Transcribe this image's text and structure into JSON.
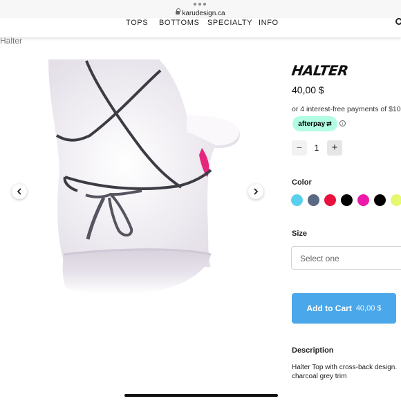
{
  "browser": {
    "url": "karudesign.ca"
  },
  "nav": {
    "items": [
      "TOPS",
      "BOTTOMS",
      "SPECIALTY",
      "INFO"
    ]
  },
  "breadcrumb": {
    "title": "Halter"
  },
  "product": {
    "name_logo": "HALTER",
    "price": "40,00 $",
    "installments_text": "or 4 interest-free payments of $10",
    "afterpay_label": "afterpay",
    "info_icon": "i",
    "quantity": {
      "minus": "−",
      "value": "1",
      "plus": "+"
    },
    "color_label": "Color",
    "colors": [
      {
        "name": "light-blue",
        "hex": "#5ad0ee"
      },
      {
        "name": "slate",
        "hex": "#596a82"
      },
      {
        "name": "red",
        "hex": "#e8103c"
      },
      {
        "name": "black",
        "hex": "#000000"
      },
      {
        "name": "magenta",
        "hex": "#ec1aa9"
      },
      {
        "name": "black-2",
        "hex": "#000000"
      },
      {
        "name": "lime",
        "hex": "#e6f86b"
      }
    ],
    "size_label": "Size",
    "size_placeholder": "Select one",
    "add_to_cart": {
      "label": "Add to Cart",
      "price": "40,00 $"
    },
    "description_label": "Description",
    "description_lines": [
      "Halter Top with cross-back design.",
      "charcoal grey trim"
    ]
  },
  "icons": {
    "prev": "chevron-left-icon",
    "next": "chevron-right-icon",
    "search": "search-icon",
    "lock": "lock-icon"
  },
  "colors": {
    "accent": "#4aa7ea",
    "afterpay": "#b2fce4"
  }
}
